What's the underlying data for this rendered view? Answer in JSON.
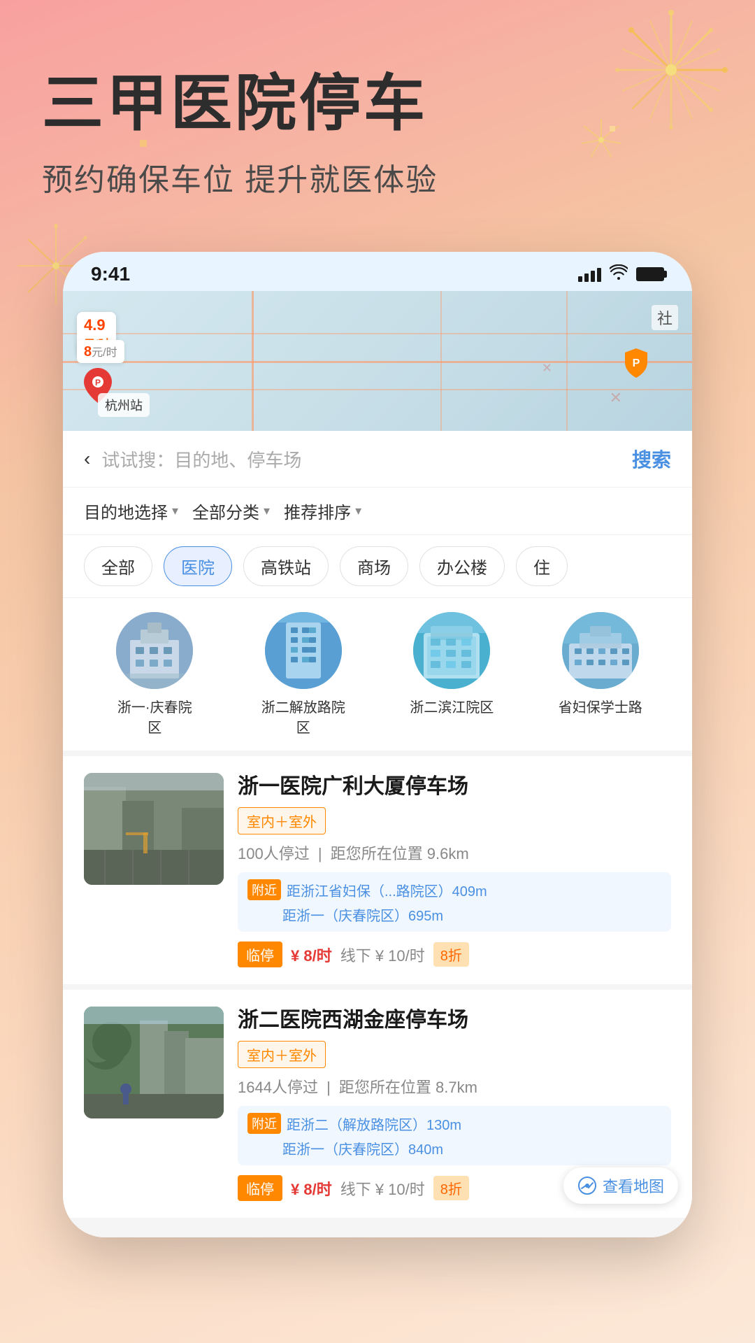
{
  "background": {
    "gradient": "linear-gradient(160deg, #f8a0a0 0%, #f5c5a3 30%, #fad4b8 60%, #fce8d8 100%)"
  },
  "header": {
    "main_title": "三甲医院停车",
    "sub_title": "预约确保车位  提升就医体验"
  },
  "status_bar": {
    "time": "9:41"
  },
  "search": {
    "placeholder": "试试搜：目的地、停车场",
    "button_label": "搜索",
    "back_icon": "‹"
  },
  "filters": [
    {
      "label": "目的地选择",
      "arrow": "▾"
    },
    {
      "label": "全部分类",
      "arrow": "▾"
    },
    {
      "label": "推荐排序",
      "arrow": "▾"
    }
  ],
  "category_tabs": [
    {
      "label": "全部",
      "active": false
    },
    {
      "label": "医院",
      "active": true
    },
    {
      "label": "高铁站",
      "active": false
    },
    {
      "label": "商场",
      "active": false
    },
    {
      "label": "办公楼",
      "active": false
    },
    {
      "label": "住",
      "active": false
    }
  ],
  "hospitals": [
    {
      "name": "浙一·庆春院区",
      "id": "hosp1"
    },
    {
      "name": "浙二解放路院区",
      "id": "hosp2"
    },
    {
      "name": "浙二滨江院区",
      "id": "hosp3"
    },
    {
      "name": "省妇保学士路",
      "id": "hosp4"
    }
  ],
  "parking_lots": [
    {
      "id": "p1",
      "name": "浙一医院广利大厦停车场",
      "tag": "室内＋室外",
      "visitors": "100人停过",
      "distance": "距您所在位置 9.6km",
      "nearby": [
        {
          "label": "距浙江省妇保（...路院区）409m"
        },
        {
          "label": "距浙一（庆春院区）695m"
        }
      ],
      "price_type": "临停",
      "price_main": "¥ 8/时",
      "price_offline": "线下 ¥ 10/时",
      "price_discount": "8折"
    },
    {
      "id": "p2",
      "name": "浙二医院西湖金座停车场",
      "tag": "室内＋室外",
      "visitors": "1644人停过",
      "distance": "距您所在位置 8.7km",
      "nearby": [
        {
          "label": "距浙二（解放路院区）130m"
        },
        {
          "label": "距浙一（庆春院区）840m"
        }
      ],
      "price_type": "临停",
      "price_main": "¥ 8/时",
      "price_offline": "线下 ¥ 10/时",
      "price_discount": "8折"
    }
  ],
  "map_view_button": "查看地图",
  "map_price": "4.9\n元/时",
  "map_location": "杭州站"
}
